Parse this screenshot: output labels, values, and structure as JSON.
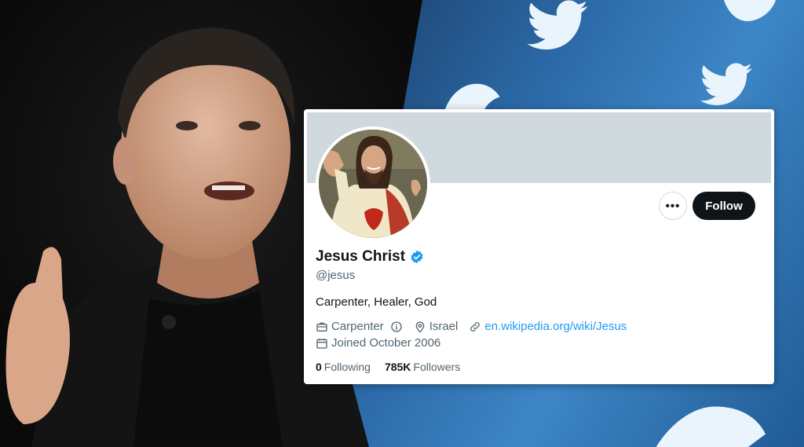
{
  "profile": {
    "name": "Jesus Christ",
    "handle": "@jesus",
    "bio": "Carpenter, Healer, God",
    "occupation": "Carpenter",
    "location": "Israel",
    "website": "en.wikipedia.org/wiki/Jesus",
    "joined": "Joined October 2006",
    "following_count": "0",
    "following_label": "Following",
    "followers_count": "785K",
    "followers_label": "Followers",
    "verified": true
  },
  "actions": {
    "more_label": "•••",
    "follow_label": "Follow"
  },
  "colors": {
    "accent": "#1d9bf0",
    "follow_bg": "#0f1419",
    "banner": "#cfd9de",
    "secondary_text": "#536471"
  },
  "icons": [
    "verified-badge-icon",
    "briefcase-icon",
    "info-icon",
    "location-pin-icon",
    "link-icon",
    "calendar-icon",
    "twitter-bird-icon"
  ]
}
